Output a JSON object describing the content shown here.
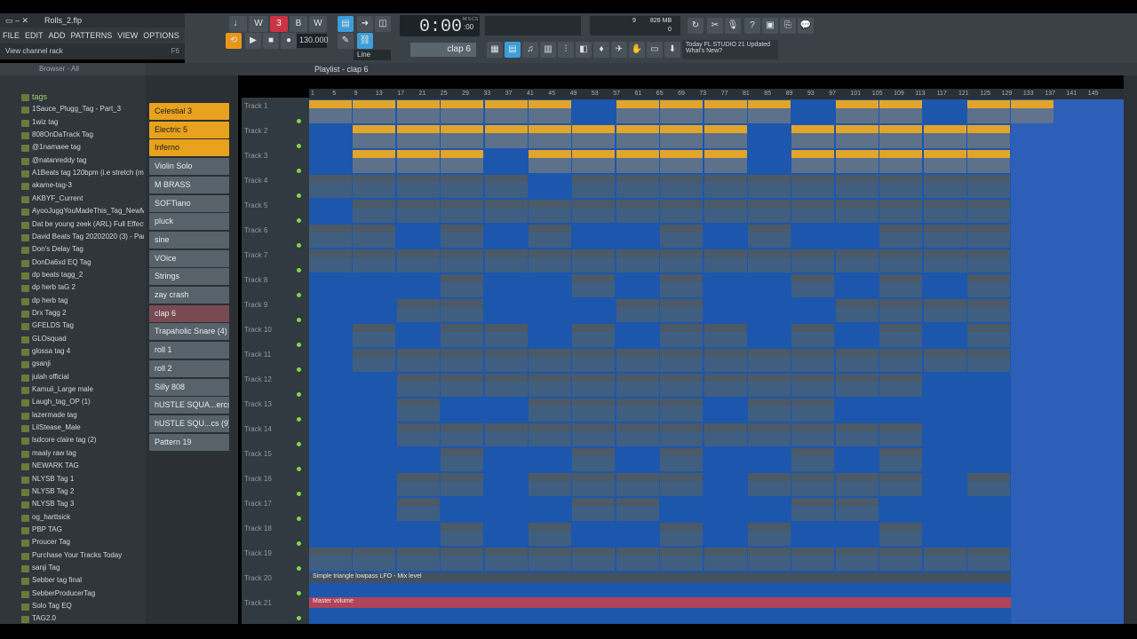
{
  "window": {
    "file": "Rolls_2.flp"
  },
  "menu": [
    "FILE",
    "EDIT",
    "ADD",
    "PATTERNS",
    "VIEW",
    "OPTIONS",
    "TOOLS",
    "?"
  ],
  "hint": {
    "text": "View channel rack",
    "shortcut": "F6"
  },
  "transport": {
    "tempo": "130.000",
    "time": "0:00",
    "time_sub": ":00",
    "time_label": "M:S:CS",
    "snap": "Line",
    "pattern": "clap 6",
    "cpu": "9",
    "mem": "828 MB",
    "mem2": "0"
  },
  "news": {
    "line1": "Today  FL STUDIO 21 Updated",
    "line2": "What's New?"
  },
  "browser": {
    "title": "Browser - All",
    "items": [
      "tags",
      "1Sauce_Plugg_Tag - Part_3",
      "1wiz tag",
      "808OnDaTrack Tag",
      "@1namaee tag",
      "@natanreddy tag",
      "A1Beats tag 120bpm (i.e stretch (must use))",
      "akame-tag-3",
      "AKBYF_Current",
      "AyooJuggYouMadeThis_Tag_NewMix",
      "Dat be young zeek (ARL) Full Effect  (2)",
      "David Beats Tag 20202020 (3) - Part_1",
      "Don's Delay Tag",
      "DonDa6xd EQ Tag",
      "dp beats tagg_2",
      "dp herb taG 2",
      "dp herb tag",
      "Drx Tagg 2",
      "GFELDS Tag",
      "GLOsquad",
      "glossa tag 4",
      "gsanji",
      "julah official",
      "Kamuii_Large male",
      "Laugh_tag_OP (1)",
      "lazermade tag",
      "LilStease_Male",
      "lsdcore claire tag (2)",
      "maaly raw tag",
      "NEWARK TAG",
      "NLYSB Tag 1",
      "NLYSB Tag 2",
      "NLYSB Tag 3",
      "og_harttsick",
      "PBP TAG",
      "Proucer Tag",
      "Purchase Your Tracks Today",
      "sanji Tag",
      "Sebber tag final",
      "SebberProducerTag",
      "Solo Tag EQ",
      "TAG2.0"
    ]
  },
  "playlist": {
    "title": "Playlist - clap 6",
    "patterns": [
      "Celestial 3",
      "Electric 5",
      "Inferno",
      "Violin Solo",
      "M BRASS",
      "SOFTiano",
      "pluck",
      "sine",
      "VOice",
      "Strings",
      "zay crash",
      "clap 6",
      "Trapaholic Snare (4)",
      "roll 1",
      "roll 2",
      "Silly 808",
      "hUSTLE SQUA...ercs (9)_9",
      "hUSTLE SQU...cs (9)_9 #2",
      "Pattern 19"
    ],
    "tracks": [
      "Track 1",
      "Track 2",
      "Track 3",
      "Track 4",
      "Track 5",
      "Track 6",
      "Track 7",
      "Track 8",
      "Track 9",
      "Track 10",
      "Track 11",
      "Track 12",
      "Track 13",
      "Track 14",
      "Track 15",
      "Track 16",
      "Track 17",
      "Track 18",
      "Track 19",
      "Track 20",
      "Track 21"
    ],
    "bars": [
      "1",
      "5",
      "9",
      "13",
      "17",
      "21",
      "25",
      "29",
      "33",
      "37",
      "41",
      "45",
      "49",
      "53",
      "57",
      "61",
      "65",
      "69",
      "73",
      "77",
      "81",
      "85",
      "89",
      "93",
      "97",
      "101",
      "105",
      "109",
      "113",
      "117",
      "121",
      "125",
      "129",
      "133",
      "137",
      "141",
      "145"
    ],
    "automation1": "Simple triangle lowpass LFO - Mix level",
    "automation2": "Master volume"
  }
}
